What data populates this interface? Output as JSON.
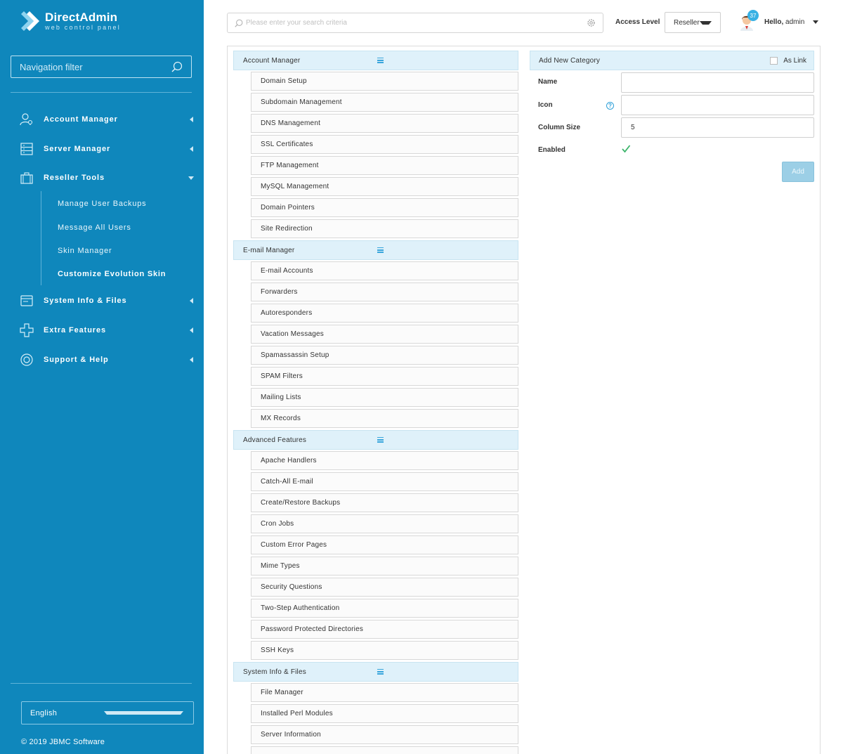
{
  "brand": {
    "title": "DirectAdmin",
    "subtitle": "web control panel"
  },
  "sidebar": {
    "filter_placeholder": "Navigation filter",
    "items": [
      {
        "label": "Account Manager"
      },
      {
        "label": "Server Manager"
      },
      {
        "label": "Reseller Tools"
      },
      {
        "label": "System Info & Files"
      },
      {
        "label": "Extra Features"
      },
      {
        "label": "Support & Help"
      }
    ],
    "reseller_sub": [
      {
        "label": "Manage User Backups"
      },
      {
        "label": "Message All Users"
      },
      {
        "label": "Skin Manager"
      },
      {
        "label": "Customize Evolution Skin"
      }
    ],
    "language": "English",
    "copyright": "© 2019 JBMC Software"
  },
  "topbar": {
    "search_placeholder": "Please enter your search criteria",
    "access_label": "Access Level",
    "access_value": "Reseller",
    "notifications": "37",
    "hello_prefix": "Hello,",
    "hello_user": "admin"
  },
  "categories": [
    {
      "title": "Account Manager",
      "items": [
        "Domain Setup",
        "Subdomain Management",
        "DNS Management",
        "SSL Certificates",
        "FTP Management",
        "MySQL Management",
        "Domain Pointers",
        "Site Redirection"
      ]
    },
    {
      "title": "E-mail Manager",
      "items": [
        "E-mail Accounts",
        "Forwarders",
        "Autoresponders",
        "Vacation Messages",
        "Spamassassin Setup",
        "SPAM Filters",
        "Mailing Lists",
        "MX Records"
      ]
    },
    {
      "title": "Advanced Features",
      "items": [
        "Apache Handlers",
        "Catch-All E-mail",
        "Create/Restore Backups",
        "Cron Jobs",
        "Custom Error Pages",
        "Mime Types",
        "Security Questions",
        "Two-Step Authentication",
        "Password Protected Directories",
        "SSH Keys"
      ]
    },
    {
      "title": "System Info & Files",
      "items": [
        "File Manager",
        "Installed Perl Modules",
        "Server Information",
        ""
      ]
    }
  ],
  "form": {
    "title": "Add New Category",
    "as_link_label": "As Link",
    "name_label": "Name",
    "name_value": "",
    "icon_label": "Icon",
    "icon_value": "",
    "help_glyph": "?",
    "column_size_label": "Column Size",
    "column_size_value": "5",
    "enabled_label": "Enabled",
    "enabled": true,
    "add_label": "Add"
  },
  "colors": {
    "sidebar": "#0f87bc",
    "header_bg": "#dff1fa",
    "accent": "#39b1e4",
    "check": "#3bb46a"
  }
}
